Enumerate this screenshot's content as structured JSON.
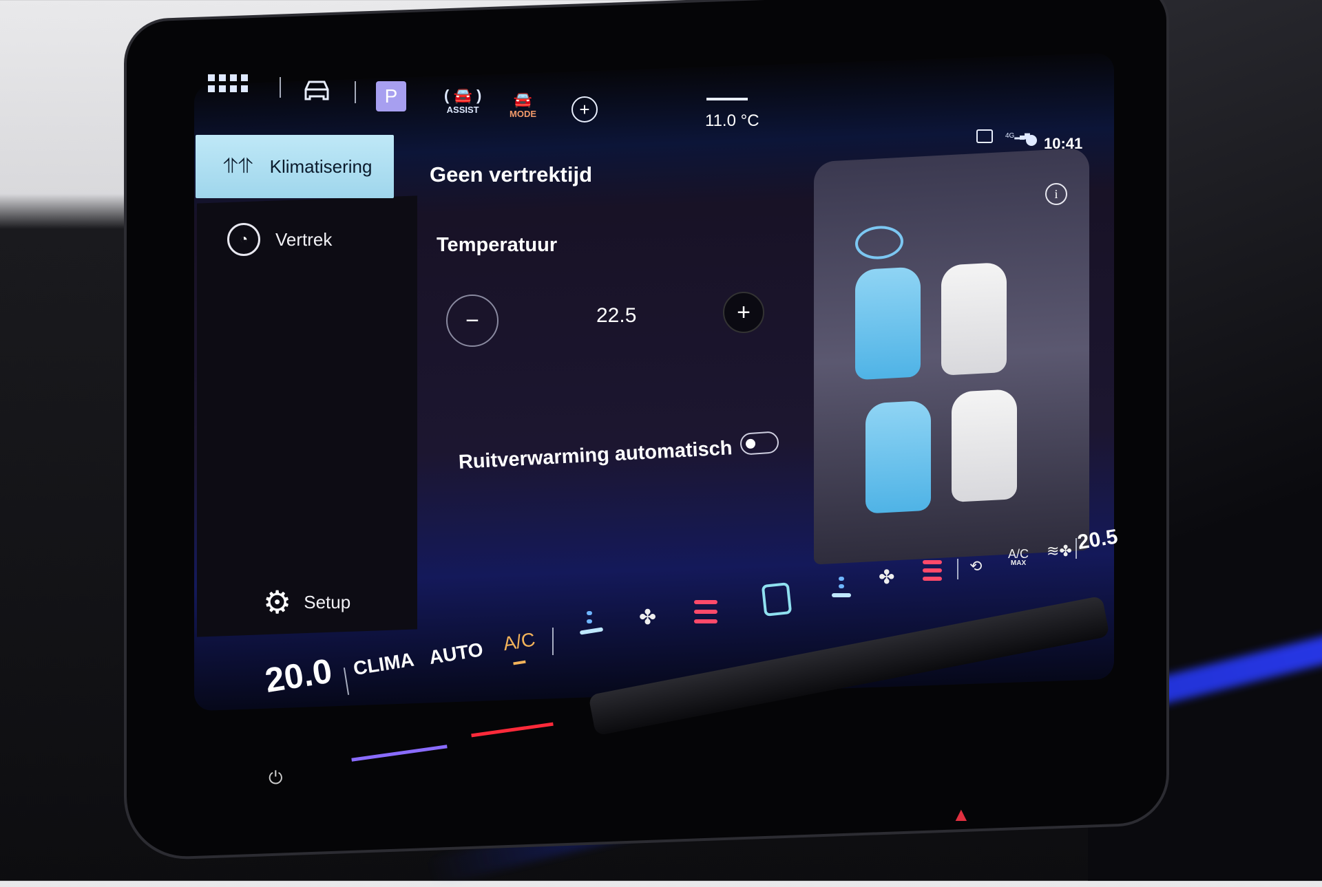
{
  "topbar": {
    "icons": [
      "apps-grid-icon",
      "car-icon",
      "parking-icon",
      "assist-icon",
      "mode-icon",
      "add-icon"
    ],
    "parking_label": "P",
    "assist_label": "ASSIST",
    "mode_label": "MODE",
    "outside_temp": "11.0 °C",
    "status_icons": [
      "message-icon",
      "signal-4g-icon",
      "globe-icon"
    ],
    "network_label": "4G",
    "time": "10:41"
  },
  "sidebar": {
    "items": [
      {
        "label": "Klimatisering",
        "icon": "climate-icon",
        "selected": true
      },
      {
        "label": "Vertrek",
        "icon": "clock-icon",
        "selected": false
      }
    ],
    "setup_label": "Setup"
  },
  "main": {
    "departure_title": "Geen vertrektijd",
    "temperature_label": "Temperatuur",
    "temperature_value": "22.5",
    "minus_label": "−",
    "plus_label": "+",
    "window_heating_label": "Ruitverwarming automatisch",
    "window_heating_on": false,
    "info_icon": "info-icon"
  },
  "climate_bar": {
    "left_temp": "20.0",
    "clima_label": "CLIMA",
    "auto_label": "AUTO",
    "ac_label": "A/C",
    "acmax_label": "A/C",
    "acmax_sub": "MAX",
    "right_temp": "20.5",
    "colors": {
      "accent_blue": "#6fb6ff",
      "heat_red": "#ff4a6a",
      "ac_orange": "#f3b35a",
      "selected_teal": "#bfe8f7"
    }
  }
}
